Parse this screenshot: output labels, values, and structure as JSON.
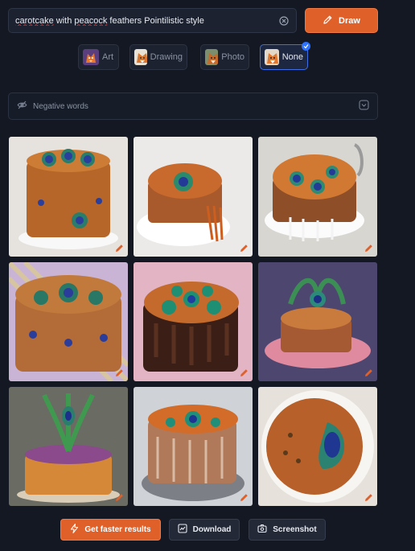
{
  "prompt": {
    "value_before": "carotcake",
    "value_middle": " with ",
    "value_spell": "peacock",
    "value_after": " feathers Pointilistic style"
  },
  "draw_button": {
    "label": "Draw"
  },
  "styles": [
    {
      "label": "Art",
      "selected": false
    },
    {
      "label": "Drawing",
      "selected": false
    },
    {
      "label": "Photo",
      "selected": false
    },
    {
      "label": "None",
      "selected": true
    }
  ],
  "negative": {
    "placeholder": "Negative words"
  },
  "actions": {
    "faster": "Get faster results",
    "download": "Download",
    "screenshot": "Screenshot"
  },
  "colors": {
    "background": "#131822",
    "accent": "#e0602a",
    "selected": "#3e6ee6"
  }
}
